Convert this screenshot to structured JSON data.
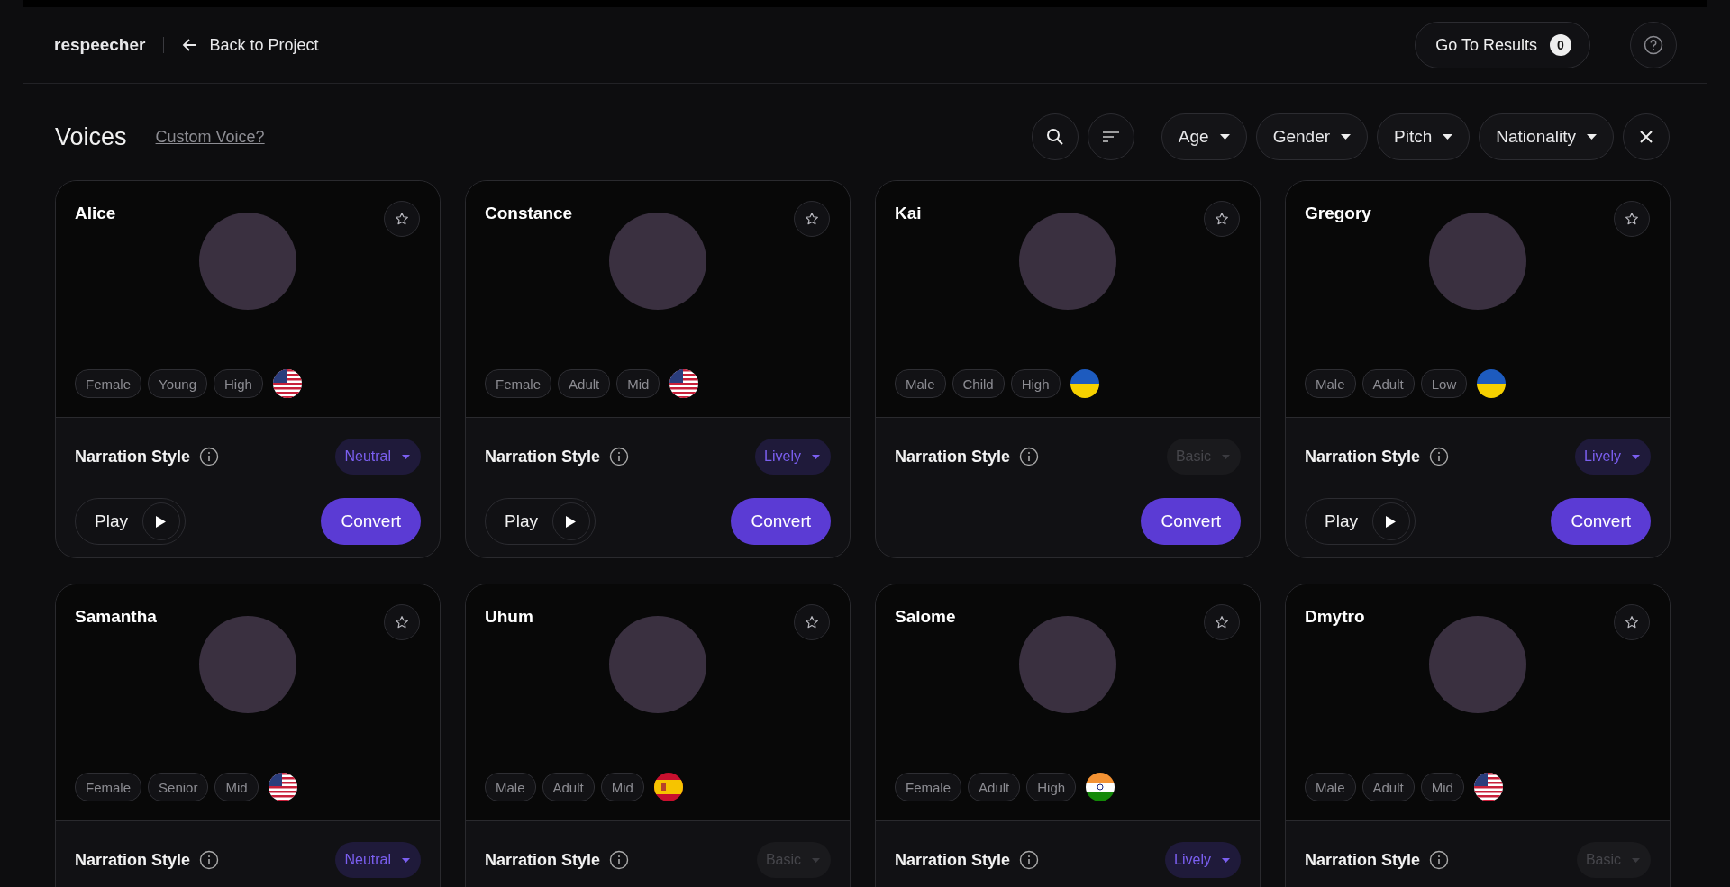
{
  "header": {
    "logo": "respeecher",
    "back_link": "Back to Project",
    "results_button": {
      "label": "Go To Results",
      "count": "0"
    }
  },
  "toolbar": {
    "title": "Voices",
    "custom_voice_link": "Custom Voice?",
    "filters": [
      {
        "label": "Age"
      },
      {
        "label": "Gender"
      },
      {
        "label": "Pitch"
      },
      {
        "label": "Nationality"
      }
    ]
  },
  "voices": [
    {
      "name": "Alice",
      "tags": [
        "Female",
        "Young",
        "High"
      ],
      "flag": {
        "kind": "us"
      },
      "style_label": "Narration Style",
      "style": {
        "value": "Neutral",
        "disabled": false
      },
      "play": "Play",
      "convert": "Convert"
    },
    {
      "name": "Constance",
      "tags": [
        "Female",
        "Adult",
        "Mid"
      ],
      "flag": {
        "kind": "us"
      },
      "style_label": "Narration Style",
      "style": {
        "value": "Lively",
        "disabled": false
      },
      "play": "Play",
      "convert": "Convert"
    },
    {
      "name": "Kai",
      "tags": [
        "Male",
        "Child",
        "High"
      ],
      "flag": {
        "kind": "ua"
      },
      "style_label": "Narration Style",
      "style": {
        "value": "Basic",
        "disabled": true
      },
      "convert": "Convert"
    },
    {
      "name": "Gregory",
      "tags": [
        "Male",
        "Adult",
        "Low"
      ],
      "flag": {
        "kind": "ua"
      },
      "style_label": "Narration Style",
      "style": {
        "value": "Lively",
        "disabled": false
      },
      "play": "Play",
      "convert": "Convert"
    },
    {
      "name": "Samantha",
      "tags": [
        "Female",
        "Senior",
        "Mid"
      ],
      "flag": {
        "kind": "us"
      },
      "style_label": "Narration Style",
      "style": {
        "value": "Neutral",
        "disabled": false
      }
    },
    {
      "name": "Uhum",
      "tags": [
        "Male",
        "Adult",
        "Mid"
      ],
      "flag": {
        "kind": "es"
      },
      "style_label": "Narration Style",
      "style": {
        "value": "Basic",
        "disabled": true
      }
    },
    {
      "name": "Salome",
      "tags": [
        "Female",
        "Adult",
        "High"
      ],
      "flag": {
        "kind": "in"
      },
      "style_label": "Narration Style",
      "style": {
        "value": "Lively",
        "disabled": false
      }
    },
    {
      "name": "Dmytro",
      "tags": [
        "Male",
        "Adult",
        "Mid"
      ],
      "flag": {
        "kind": "us"
      },
      "style_label": "Narration Style",
      "style": {
        "value": "Basic",
        "disabled": true
      }
    }
  ]
}
